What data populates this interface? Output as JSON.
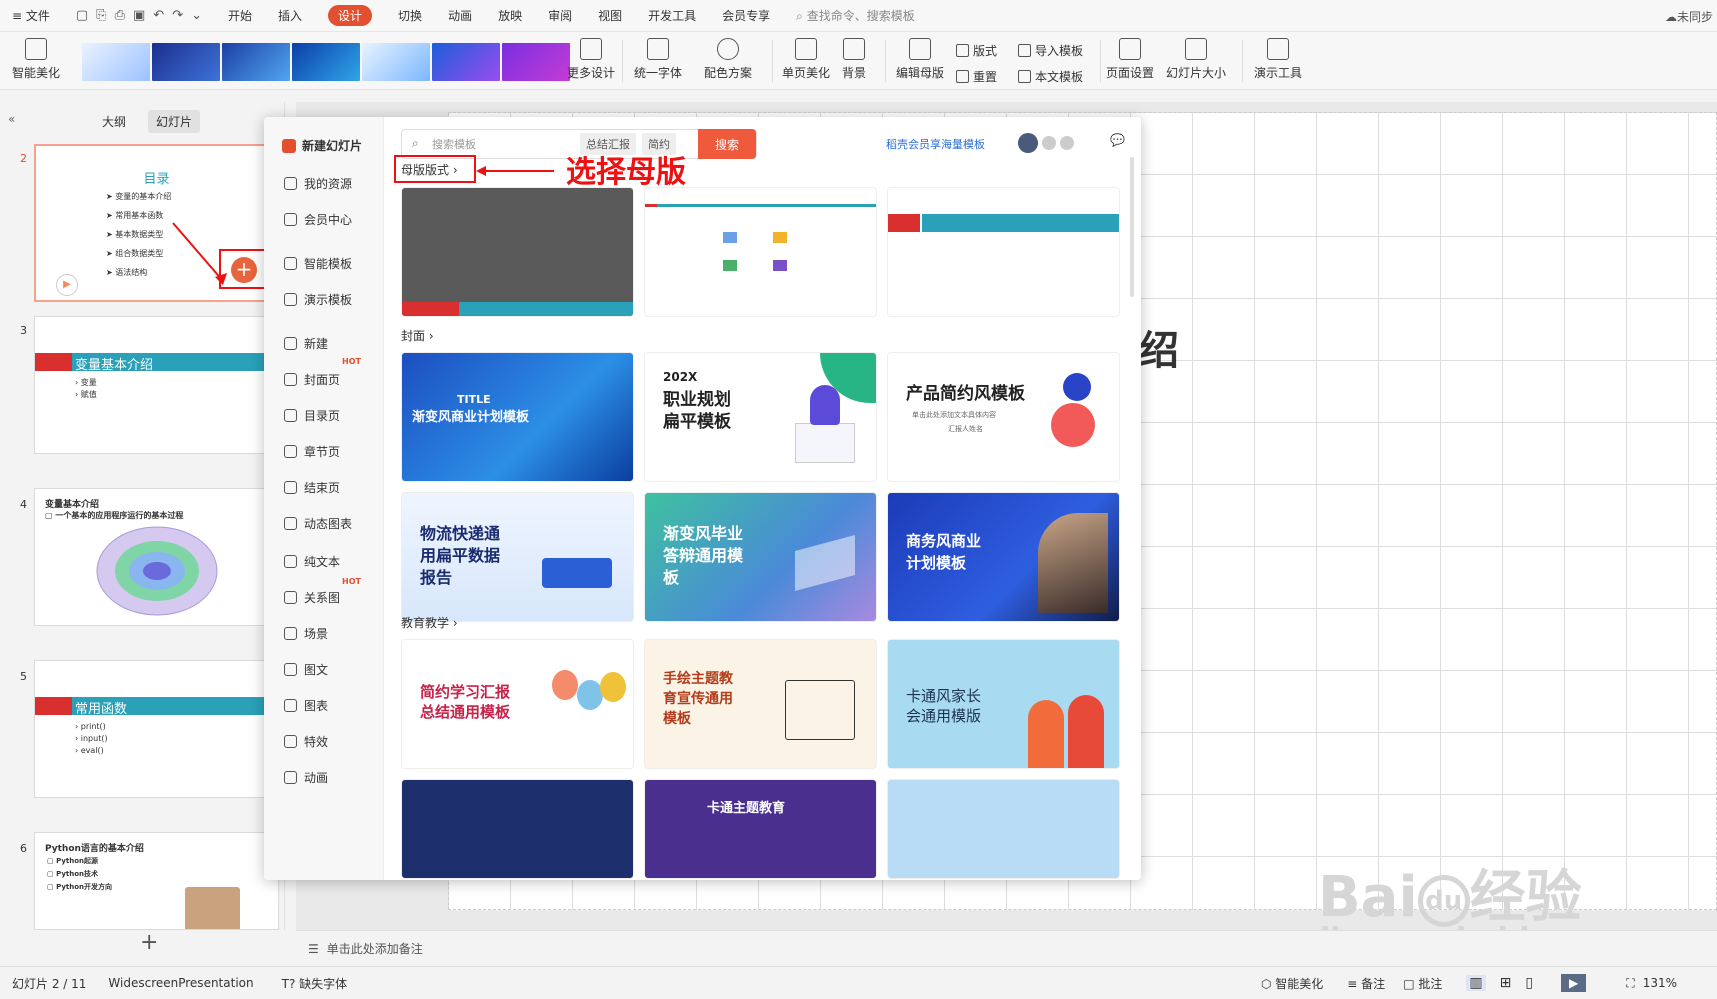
{
  "menubar": {
    "file": "≡ 文件",
    "items": [
      "开始",
      "插入",
      "设计",
      "切换",
      "动画",
      "放映",
      "审阅",
      "视图",
      "开发工具",
      "会员专享"
    ],
    "active": "设计",
    "search": "查找命令、搜索模板",
    "cloud": "未同步"
  },
  "ribbon": {
    "smart": "智能美化",
    "more_design": "更多设计",
    "unify_font": "统一字体",
    "color_scheme": "配色方案",
    "single_beautify": "单页美化",
    "background": "背景",
    "edit_master": "编辑母版",
    "layout": "版式",
    "reset": "重置",
    "import_template": "导入模板",
    "text_template": "本文模板",
    "page_setup": "页面设置",
    "slide_size": "幻灯片大小",
    "present_tools": "演示工具"
  },
  "left": {
    "tab_outline": "大纲",
    "tab_slides": "幻灯片",
    "slides": [
      {
        "num": "2",
        "title": "目录",
        "bullets": [
          "变量的基本介绍",
          "常用基本函数",
          "基本数据类型",
          "组合数据类型",
          "语法结构"
        ]
      },
      {
        "num": "3",
        "title": "变量基本介绍",
        "bullets": [
          "变量",
          "赋值"
        ]
      },
      {
        "num": "4",
        "title": "变量基本介绍",
        "sub": "一个基本的应用程序运行的基本过程"
      },
      {
        "num": "5",
        "title": "常用函数",
        "bullets": [
          "print()",
          "input()",
          "eval()"
        ]
      },
      {
        "num": "6",
        "title": "Python语言的基本介绍",
        "bullets": [
          "Python起源",
          "Python技术",
          "Python开发方向"
        ]
      }
    ],
    "add": "+"
  },
  "popup": {
    "title": "新建幻灯片",
    "nav": [
      "我的资源",
      "会员中心",
      "智能模板",
      "演示模板",
      "新建",
      "封面页",
      "目录页",
      "章节页",
      "结束页",
      "动态图表",
      "纯文本",
      "关系图",
      "场景",
      "图文",
      "图表",
      "特效",
      "动画"
    ],
    "hot": "HOT",
    "search_placeholder": "搜索模板",
    "tag1": "总结汇报",
    "tag2": "简约",
    "search_btn": "搜索",
    "member_link": "稻壳会员享海量模板",
    "master_label": "母版版式",
    "cover_label": "封面",
    "edu_label": "教育教学",
    "covers": [
      {
        "l1": "TITLE",
        "l2": "渐变风商业计划模板"
      },
      {
        "l1": "202X",
        "l2": "职业规划",
        "l3": "扁平模板"
      },
      {
        "l1": "产品简约风模板",
        "l2": "单击此处添加文本具体内容",
        "l3": "汇报人姓名"
      },
      {
        "l1": "物流快递通",
        "l2": "用扁平数据",
        "l3": "报告"
      },
      {
        "l1": "渐变风毕业",
        "l2": "答辩通用模",
        "l3": "板"
      },
      {
        "l1": "商务风商业",
        "l2": "计划模板"
      }
    ],
    "edu": [
      {
        "l1": "简约学习汇报",
        "l2": "总结通用模板"
      },
      {
        "l1": "手绘主题教",
        "l2": "育宣传通用",
        "l3": "模板"
      },
      {
        "l1": "卡通风家长",
        "l2": "会通用模版"
      }
    ],
    "edu_bottom": "卡通主题教育"
  },
  "annotation": "选择母版",
  "slide_partial": "绍",
  "notes": "单击此处添加备注",
  "status": {
    "slide": "幻灯片 2 / 11",
    "theme": "WidescreenPresentation",
    "font": "缺失字体",
    "smart": "智能美化",
    "notes": "备注",
    "comment": "批注",
    "zoom": "131%"
  },
  "watermark": {
    "a": "Bai",
    "b": "du",
    "c": "经验",
    "d": "jingyan.baidu.com"
  },
  "colors": {
    "accent": "#e2502f",
    "teal": "#2aa0b9",
    "red": "#d9302f"
  }
}
